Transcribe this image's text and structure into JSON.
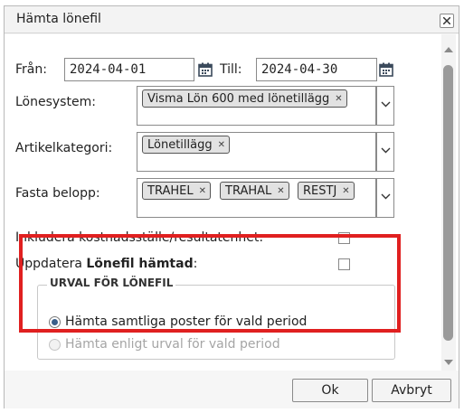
{
  "dialog": {
    "title": "Hämta lönefil",
    "close_icon": "close-icon"
  },
  "period": {
    "from_label": "Från:",
    "from_value": "2024-04-01",
    "to_label": "Till:",
    "to_value": "2024-04-30",
    "calendar_icon": "calendar-icon"
  },
  "lonesystem": {
    "label": "Lönesystem:",
    "tags": [
      "Visma Lön 600 med lönetillägg"
    ]
  },
  "artikelkategori": {
    "label": "Artikelkategori:",
    "tags": [
      "Lönetillägg"
    ]
  },
  "fasta_belopp": {
    "label": "Fasta belopp:",
    "tags": [
      "TRAHEL",
      "TRAHAL",
      "RESTJ"
    ]
  },
  "options": {
    "include_cost_center_label": "Inkludera kostnadsställe/resultatenhet:",
    "include_cost_center_checked": false,
    "update_label_prefix": "Uppdatera ",
    "update_label_bold": "Lönefil hämtad",
    "update_label_suffix": ":",
    "update_checked": false
  },
  "urval": {
    "legend": "URVAL FÖR LÖNEFIL",
    "radio_all": "Hämta samtliga poster för vald period",
    "radio_selection": "Hämta enligt urval för vald period",
    "selected": "all"
  },
  "footer": {
    "ok_label": "Ok",
    "cancel_label": "Avbryt"
  },
  "colors": {
    "highlight": "#e02020",
    "radio_selected": "#3a5f8a"
  }
}
